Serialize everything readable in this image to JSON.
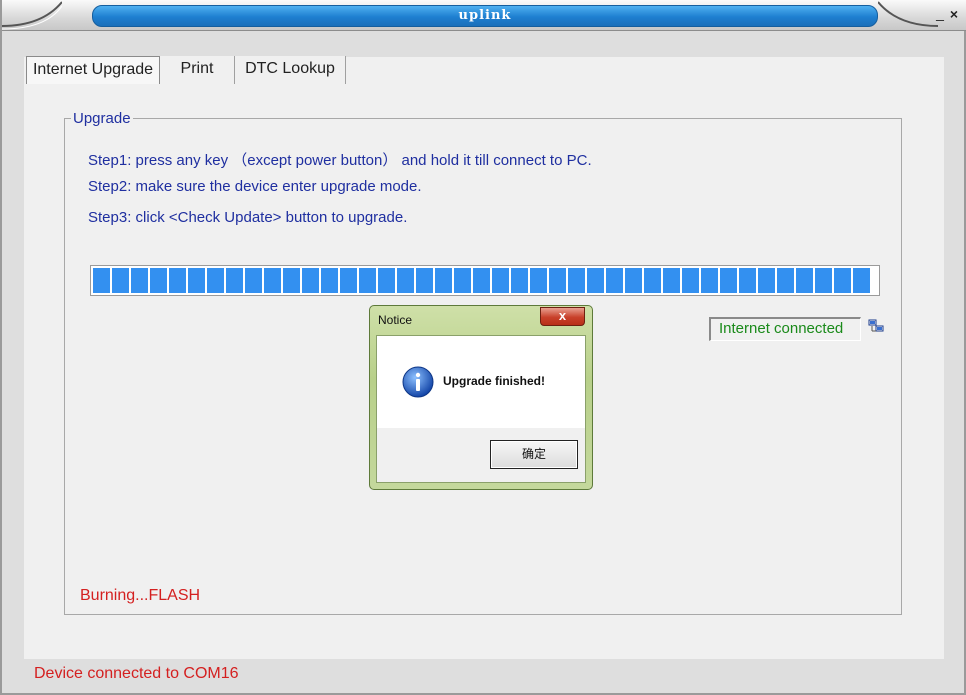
{
  "window": {
    "title": "uplink",
    "minimize_label": "_",
    "close_label": "×"
  },
  "tabs": [
    {
      "label": "Internet Upgrade",
      "active": true
    },
    {
      "label": "Print",
      "active": false
    },
    {
      "label": "DTC Lookup",
      "active": false
    }
  ],
  "upgrade": {
    "group_label": "Upgrade",
    "steps": [
      "Step1: press any key （except power button） and hold it till connect to PC.",
      "Step2: make sure the device enter upgrade mode.",
      "Step3: click <Check Update> button to upgrade."
    ],
    "progress_percent": 100,
    "internet_status": "Internet connected",
    "network_icon": "network-icon",
    "burning_status": "Burning...FLASH"
  },
  "statusbar": {
    "text": "Device connected to COM16"
  },
  "dialog": {
    "title": "Notice",
    "close_label": "x",
    "icon": "info-icon",
    "message": "Upgrade finished!",
    "ok_label": "确定"
  },
  "colors": {
    "title_bar": "#1e7fd0",
    "progress": "#3390f0",
    "step_text": "#1f2fa0",
    "status_green": "#1a8a1a",
    "status_red": "#d42020"
  }
}
